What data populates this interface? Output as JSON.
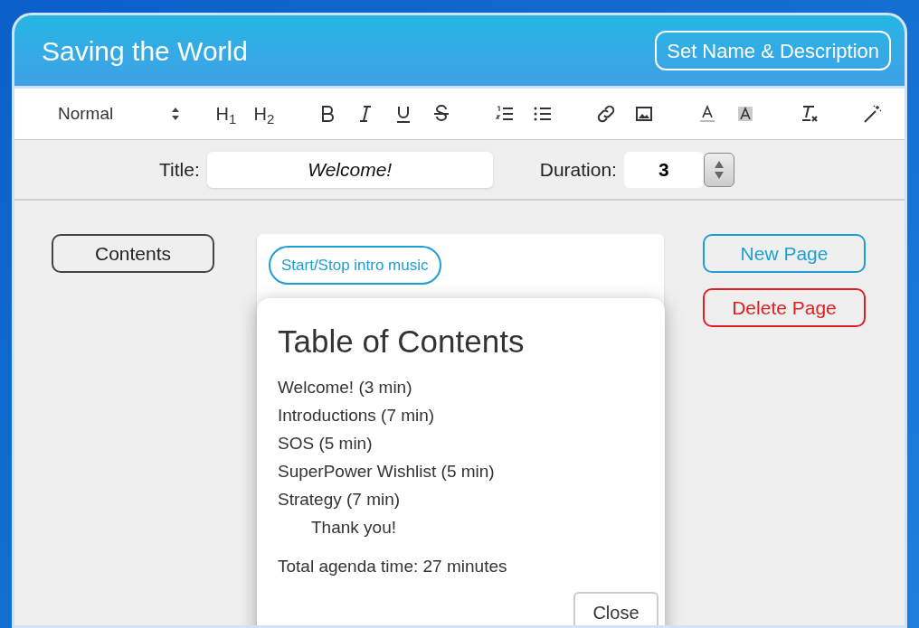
{
  "window": {
    "title": "Saving the World",
    "action": "Set Name & Description"
  },
  "toolbar": {
    "format": "Normal",
    "groups": [
      [
        {
          "kind": "text",
          "label": "H$_{1}$"
        },
        {
          "kind": "text",
          "label": "H$_{2}$"
        }
      ],
      [
        {
          "kind": "bold"
        },
        {
          "kind": "italic"
        },
        {
          "kind": "underline"
        },
        {
          "kind": "strike"
        }
      ],
      [
        {
          "kind": "ol"
        },
        {
          "kind": "ul"
        }
      ],
      [
        {
          "kind": "link"
        },
        {
          "kind": "image"
        }
      ],
      [
        {
          "kind": "color"
        },
        {
          "kind": "background"
        }
      ],
      [
        {
          "kind": "clear"
        }
      ],
      [
        {
          "kind": "wand"
        }
      ]
    ]
  },
  "fields": {
    "title_label": "Title:",
    "title_value": "Welcome!",
    "duration_label": "Duration:",
    "duration_value": "3"
  },
  "contents_button": "Contents",
  "music_button": "Start/Stop intro music",
  "side_buttons": [
    {
      "label": "New Page",
      "kind": "primary"
    },
    {
      "label": "Delete Page",
      "kind": "danger"
    }
  ],
  "dialog": {
    "title": "Table of Contents",
    "items": [
      {
        "label": "Welcome! (3 min)"
      },
      {
        "label": "Introductions (7 min)"
      },
      {
        "label": "SOS (5 min)"
      },
      {
        "label": "SuperPower Wishlist (5 min)"
      },
      {
        "label": "Strategy (7 min)",
        "children": [
          {
            "label": "Thank you!"
          }
        ]
      }
    ],
    "total": "Total agenda time: 27 minutes",
    "close": "Close"
  }
}
